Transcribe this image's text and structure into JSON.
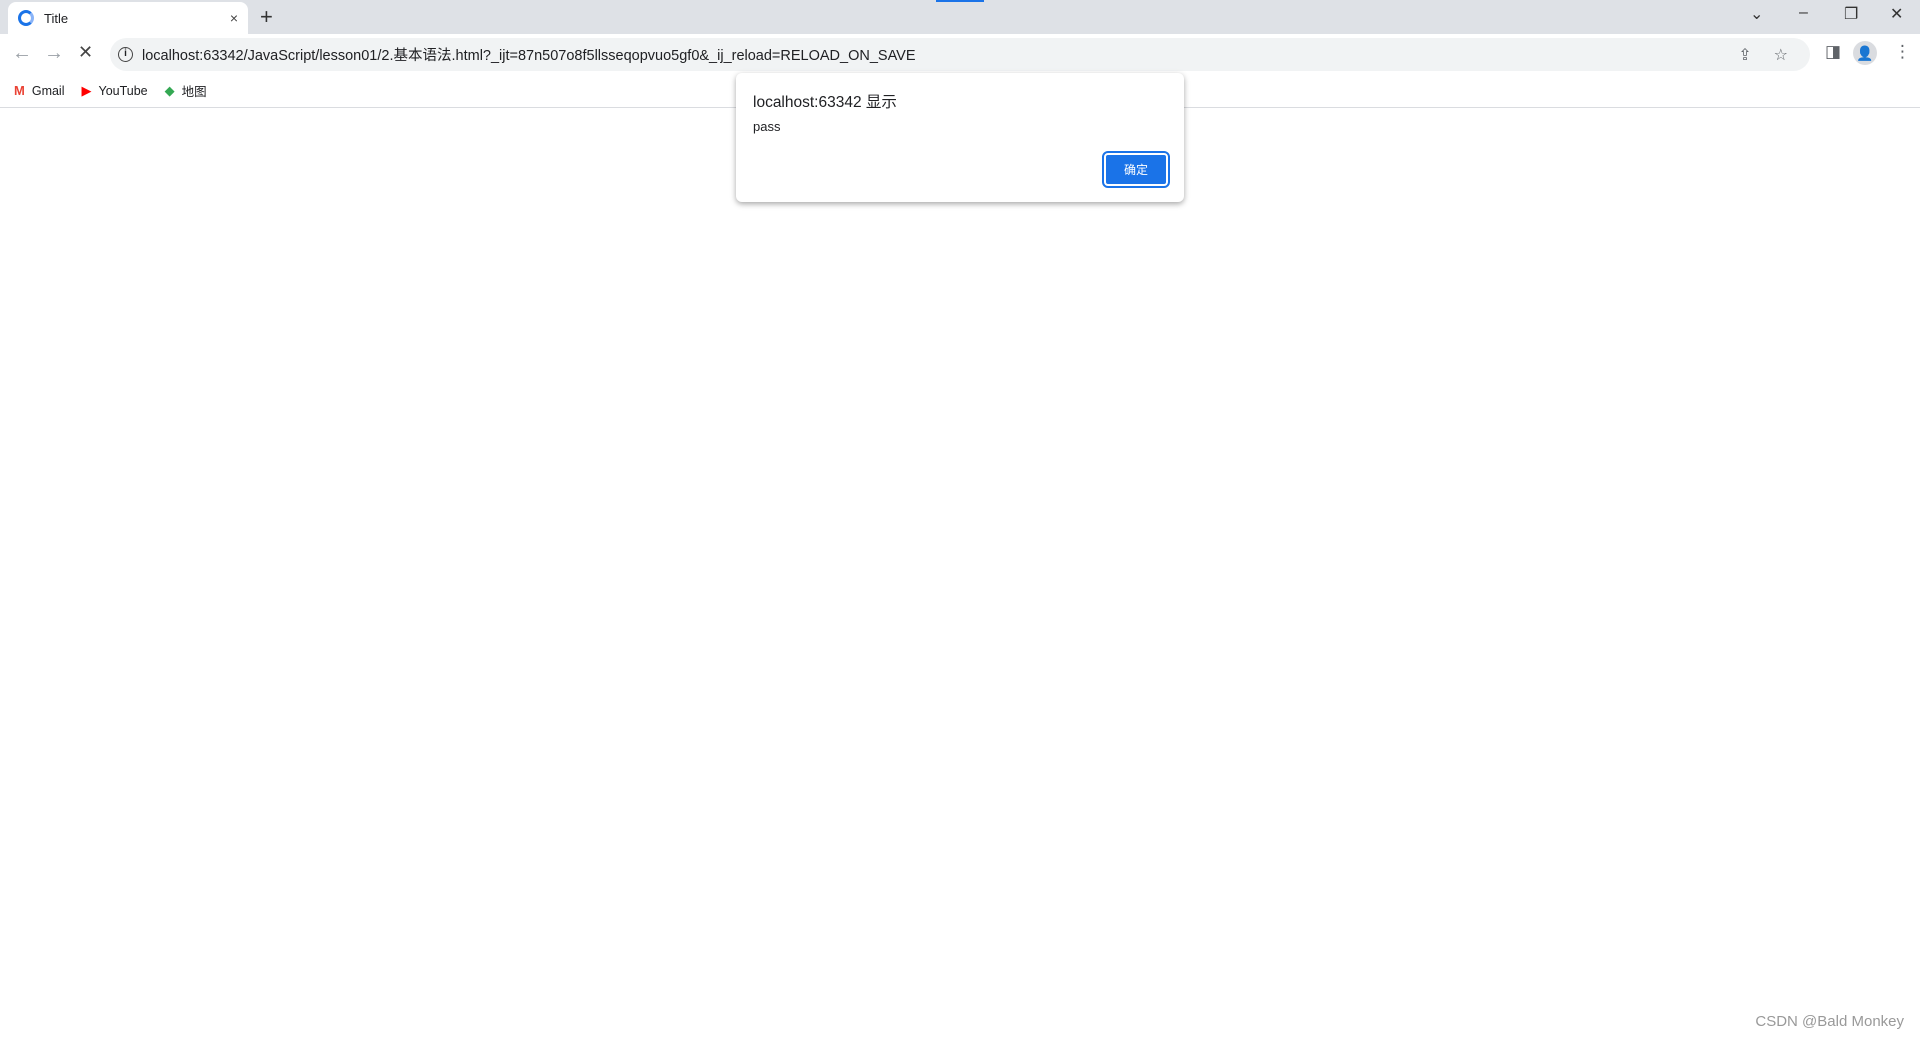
{
  "tab": {
    "title": "Title",
    "close": "×",
    "new_tab": "+"
  },
  "window": {
    "tab_search": "⌄",
    "minimize": "–",
    "restore": "❐",
    "close": "✕"
  },
  "toolbar": {
    "back": "←",
    "forward": "→",
    "stop": "✕",
    "info": "i",
    "url": "localhost:63342/JavaScript/lesson01/2.基本语法.html?_ijt=87n507o8f5llsseqopvuo5gf0&_ij_reload=RELOAD_ON_SAVE",
    "share": "⇪",
    "star": "☆",
    "sidepanel": "◨",
    "profile": "👤",
    "menu": "⋮"
  },
  "bookmarks": [
    {
      "icon": "M",
      "label": "Gmail",
      "color": "#ea4335"
    },
    {
      "icon": "▶",
      "label": "YouTube",
      "color": "#ff0000"
    },
    {
      "icon": "◆",
      "label": "地图",
      "color": "#34a853"
    }
  ],
  "dialog": {
    "title": "localhost:63342 显示",
    "message": "pass",
    "ok": "确定"
  },
  "watermark": "CSDN @Bald Monkey"
}
